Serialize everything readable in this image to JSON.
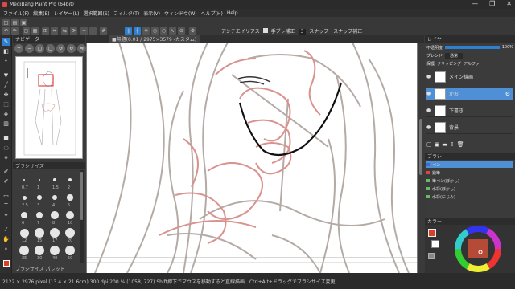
{
  "window": {
    "title": "MediBang Paint Pro (64bit)",
    "controls": [
      "—",
      "❐",
      "✕"
    ]
  },
  "menu": [
    "ファイル(F)",
    "編集(E)",
    "レイヤー(L)",
    "選択範囲(S)",
    "フィルタ(T)",
    "表示(V)",
    "ウィンドウ(W)",
    "ヘルプ(H)",
    "Help"
  ],
  "toolbar": {
    "antialias_label": "アンチエイリアス",
    "correction_label": "手ブレ補正",
    "correction_value": "3",
    "snap_label": "スナップ",
    "extra_label": "スナップ補正"
  },
  "canvas": {
    "tab_label": "■無題(0.01 / 2975×3579 -カスタム)"
  },
  "navigator": {
    "title": "ナビゲーター"
  },
  "brush_panel": {
    "title": "ブラシサイズ",
    "footer_label": "ブラシサイズ パレット",
    "sizes": [
      "0.7",
      "1",
      "1.5",
      "2",
      "2.5",
      "3",
      "4",
      "5",
      "6",
      "7",
      "8",
      "10",
      "12",
      "15",
      "17",
      "20",
      "25",
      "30",
      "40",
      "50"
    ]
  },
  "layers_panel": {
    "title": "レイヤー",
    "opacity_label": "不透明度",
    "opacity_value": "100%",
    "blend_label": "ブレンド",
    "blend_value": "通常",
    "options_label": "保護",
    "options_value": "クリッピング",
    "alpha_label": "アルファ",
    "layers": [
      {
        "name": "メイン線画",
        "selected": false
      },
      {
        "name": "かお",
        "selected": true
      },
      {
        "name": "下書き",
        "selected": false
      },
      {
        "name": "背景",
        "selected": false
      }
    ]
  },
  "brush_list": {
    "title": "ブラシ",
    "items": [
      {
        "name": "ペン",
        "color": "#3a6bd4"
      },
      {
        "name": "鉛筆",
        "color": "#d44"
      },
      {
        "name": "筆ペン(ぼかし)",
        "color": "#6b6"
      },
      {
        "name": "水彩(ぼかし)",
        "color": "#6b6"
      },
      {
        "name": "水彩(にじみ)",
        "color": "#6b6"
      }
    ]
  },
  "color_panel": {
    "title": "カラー",
    "fg_color": "#d7412a",
    "bg_color": "#ffffff"
  },
  "status": {
    "text": "2122 × 2976 pixel  (13.4 × 21.6cm)  300 dpi  200 %  (1058, 727)  Shift押下でマウスを移動すると直線描画、Ctrl+Alt+ドラッグでブラシサイズ変更"
  },
  "tools": [
    "brush",
    "eraser",
    "dot",
    "fill-bucket",
    "line",
    "select",
    "move",
    "gradient",
    "shape",
    "text",
    "eyedropper",
    "hand"
  ]
}
